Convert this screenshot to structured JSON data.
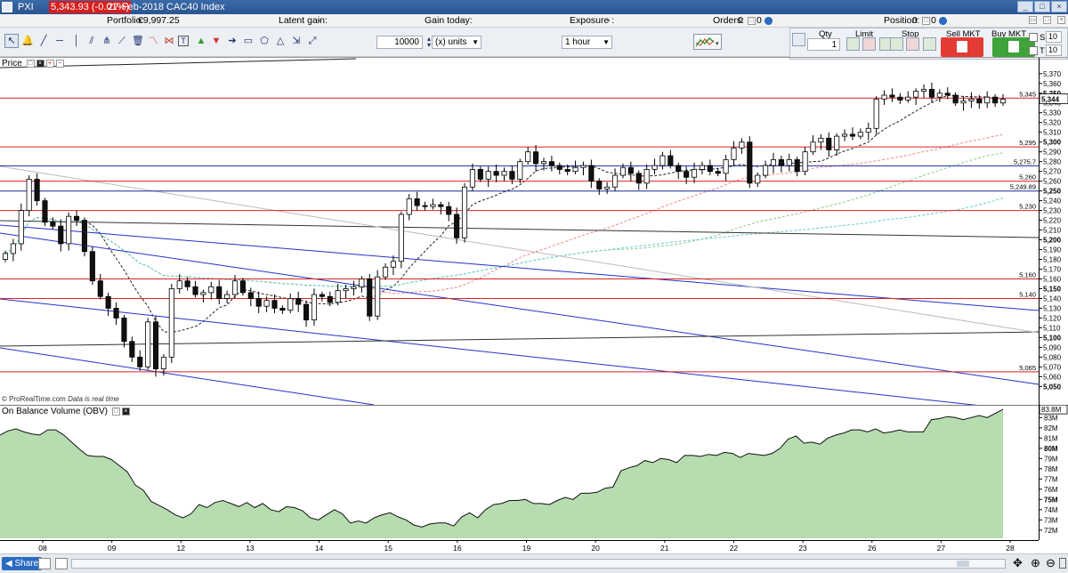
{
  "window": {
    "name": "PXI",
    "price_badge": "5,343.93 (-0.01%)",
    "date_instrument": "27-Feb-2018 CAC40 Index",
    "controls": [
      "_",
      "□",
      "×"
    ]
  },
  "info": {
    "portfolio_label": "Portfolio:",
    "portfolio_value": "€9,997.25",
    "latent_label": "Latent gain:",
    "latent_value": "-",
    "gain_label": "Gain today:",
    "gain_value": "-",
    "exposure_label": "Exposure :",
    "exposure_value": "-",
    "orders_label": "Orders:",
    "orders_value": "0",
    "orders_zero": "0",
    "position_label": "Position:",
    "position_value": "0",
    "position_zero": "0"
  },
  "toolbar": {
    "quantity": "10000",
    "units": "(x) units",
    "timeframe": "1 hour"
  },
  "order_panel": {
    "qty_label": "Qty",
    "qty_value": "1",
    "limit_label": "Limit",
    "stop_label": "Stop",
    "sell_label": "Sell MKT",
    "buy_label": "Buy MKT",
    "s_label": "S",
    "t_label": "T",
    "s_value": "10",
    "t_value": "10"
  },
  "price_panel": {
    "title": "Price",
    "source": "© ProRealTime.com",
    "source_note": "Data is real time"
  },
  "obv_panel": {
    "title": "On Balance Volume (OBV)"
  },
  "bottom": {
    "share_label": "Share"
  },
  "chart_data": [
    {
      "type": "candlestick",
      "title": "Price",
      "instrument": "CAC40 Index",
      "timeframe": "1 hour",
      "ylim": [
        5043,
        5378
      ],
      "yticks": [
        5050,
        5060,
        5070,
        5080,
        5090,
        5100,
        5110,
        5120,
        5130,
        5140,
        5150,
        5160,
        5170,
        5180,
        5190,
        5200,
        5210,
        5220,
        5230,
        5240,
        5250,
        5260,
        5270,
        5280,
        5290,
        5300,
        5310,
        5320,
        5330,
        5340,
        5350,
        5360,
        5370
      ],
      "x_days": [
        "08",
        "09",
        "12",
        "13",
        "14",
        "15",
        "16",
        "19",
        "20",
        "21",
        "22",
        "23",
        "26",
        "27",
        "28"
      ],
      "close_series": [
        5186,
        5196,
        5230,
        5262,
        5240,
        5218,
        5214,
        5196,
        5224,
        5220,
        5188,
        5158,
        5142,
        5130,
        5120,
        5096,
        5080,
        5070,
        5116,
        5068,
        5080,
        5150,
        5158,
        5152,
        5144,
        5146,
        5152,
        5140,
        5144,
        5158,
        5146,
        5140,
        5132,
        5138,
        5130,
        5128,
        5140,
        5134,
        5118,
        5144,
        5142,
        5136,
        5148,
        5150,
        5152,
        5160,
        5122,
        5162,
        5172,
        5178,
        5226,
        5242,
        5235,
        5234,
        5236,
        5234,
        5226,
        5202,
        5254,
        5272,
        5262,
        5270,
        5266,
        5270,
        5262,
        5280,
        5290,
        5278,
        5280,
        5276,
        5272,
        5270,
        5274,
        5276,
        5260,
        5252,
        5254,
        5266,
        5274,
        5268,
        5258,
        5272,
        5276,
        5286,
        5276,
        5270,
        5264,
        5272,
        5276,
        5270,
        5268,
        5282,
        5294,
        5300,
        5258,
        5266,
        5276,
        5282,
        5276,
        5282,
        5270,
        5290,
        5300,
        5304,
        5292,
        5306,
        5308,
        5306,
        5310,
        5314,
        5344,
        5348,
        5346,
        5343,
        5346,
        5352,
        5354,
        5346,
        5350,
        5348,
        5340,
        5342,
        5344,
        5340,
        5346,
        5340,
        5343.93
      ],
      "horizontal_levels": [
        5345,
        5295,
        5275.7,
        5260,
        5249.89,
        5230,
        5160,
        5140,
        5065
      ],
      "level_labels": [
        "5,345",
        "5,295",
        "5,275.7",
        "5,260",
        "5,249.89",
        "5,230",
        "5,160",
        "5,140",
        "5,065"
      ]
    },
    {
      "type": "area",
      "title": "On Balance Volume (OBV)",
      "ylim": [
        71.2,
        83.9
      ],
      "yticks": [
        72,
        73,
        74,
        75,
        76,
        77,
        78,
        79,
        80,
        81,
        82,
        83
      ],
      "ytick_labels": [
        "72M",
        "73M",
        "74M",
        "75M",
        "76M",
        "77M",
        "78M",
        "79M",
        "80M",
        "81M",
        "82M",
        "83M"
      ],
      "last_value_label": "83.8M",
      "values": [
        81.3,
        81.7,
        81.9,
        81.6,
        81.4,
        81.3,
        81.8,
        81.8,
        81.3,
        80.6,
        79.9,
        79.3,
        79.2,
        79.2,
        78.9,
        78.3,
        77.7,
        76.4,
        75.9,
        74.8,
        74.4,
        74.0,
        73.5,
        73.2,
        73.6,
        74.5,
        74.2,
        74.7,
        74.9,
        74.6,
        74.3,
        74.7,
        74.2,
        74.6,
        74.0,
        73.8,
        74.3,
        74.2,
        73.9,
        73.2,
        73.0,
        73.5,
        74.0,
        73.6,
        72.7,
        72.9,
        72.7,
        73.2,
        73.5,
        73.7,
        73.3,
        73.0,
        72.5,
        72.3,
        72.6,
        72.7,
        72.7,
        72.4,
        73.3,
        73.7,
        73.2,
        74.0,
        74.5,
        74.6,
        74.9,
        74.9,
        75.0,
        74.6,
        74.6,
        74.5,
        74.9,
        75.2,
        75.0,
        75.6,
        75.6,
        75.7,
        76.1,
        76.2,
        77.8,
        78.1,
        78.3,
        78.8,
        78.6,
        79.0,
        78.9,
        78.6,
        79.3,
        79.3,
        79.2,
        79.4,
        79.3,
        79.6,
        79.5,
        79.1,
        79.5,
        79.4,
        79.3,
        79.5,
        80.0,
        80.9,
        81.2,
        80.5,
        80.6,
        80.4,
        81.0,
        81.3,
        81.5,
        81.8,
        81.8,
        81.6,
        81.9,
        81.5,
        81.6,
        81.8,
        81.6,
        81.6,
        81.6,
        82.8,
        82.9,
        83.1,
        83.0,
        82.8,
        83.0,
        83.2,
        83.0,
        83.4,
        83.8
      ]
    }
  ]
}
